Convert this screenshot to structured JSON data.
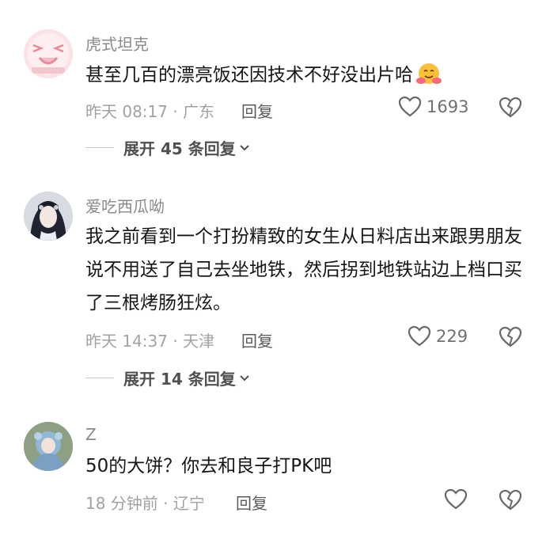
{
  "comments": [
    {
      "username": "虎式坦克",
      "content": "甚至几百的漂亮饭还因技术不好没出片哈",
      "emoji": "hugging-face-emoji",
      "time_location": "昨天 08:17 · 广东",
      "reply_label": "回复",
      "likes": "1693",
      "expand_label": "展开 45 条回复"
    },
    {
      "username": "爱吃西瓜呦",
      "content": "我之前看到一个打扮精致的女生从日料店出来跟男朋友说不用送了自己去坐地铁，然后拐到地铁站边上档口买了三根烤肠狂炫。",
      "time_location": "昨天 14:37 · 天津",
      "reply_label": "回复",
      "likes": "229",
      "expand_label": "展开 14 条回复"
    },
    {
      "username": "Z",
      "content": "50的大饼？你去和良子打PK吧",
      "time_location": "18 分钟前 · 辽宁",
      "reply_label": "回复",
      "likes": ""
    }
  ],
  "colors": {
    "username": "#8a8a8a",
    "text": "#161616",
    "meta": "#a2a2a2",
    "icon": "#707070"
  }
}
